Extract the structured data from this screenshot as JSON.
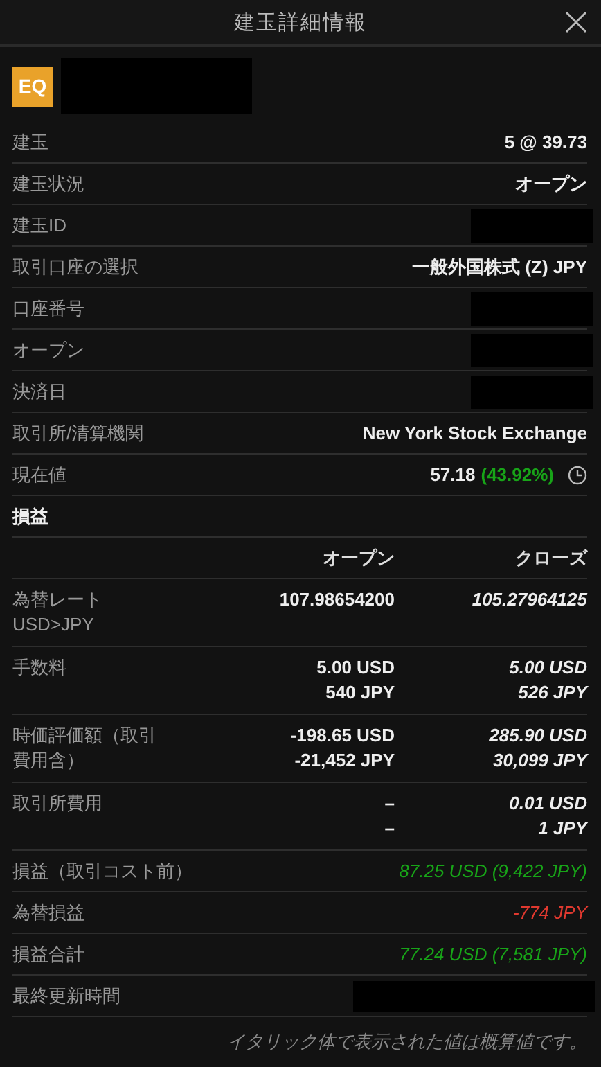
{
  "window": {
    "title": "建玉詳細情報"
  },
  "instrument": {
    "badge": "EQ"
  },
  "details": [
    {
      "label": "建玉",
      "value": "5 @ 39.73"
    },
    {
      "label": "建玉状況",
      "value": "オープン"
    },
    {
      "label": "建玉ID"
    },
    {
      "label": "取引口座の選択",
      "value": "一般外国株式 (Z) JPY"
    },
    {
      "label": "口座番号"
    },
    {
      "label": "オープン"
    },
    {
      "label": "決済日"
    },
    {
      "label": "取引所/清算機関",
      "value": "New York Stock Exchange"
    },
    {
      "label": "現在値",
      "value": "57.18",
      "change": "(43.92%)",
      "positive": true
    }
  ],
  "pnl": {
    "title": "損益",
    "columns": [
      "オープン",
      "クローズ"
    ],
    "rows": [
      {
        "label": "為替レート USD>JPY",
        "open": {
          "lines": [
            "107.98654200"
          ],
          "estimated": false
        },
        "close": {
          "lines": [
            "105.27964125"
          ],
          "estimated": true
        }
      },
      {
        "label": "手数料",
        "open": {
          "lines": [
            "5.00 USD",
            "540 JPY"
          ],
          "estimated": false
        },
        "close": {
          "lines": [
            "5.00 USD",
            "526 JPY"
          ],
          "estimated": true
        }
      },
      {
        "label": "時価評価額（取引費用含）",
        "open": {
          "lines": [
            "-198.65 USD",
            "-21,452 JPY"
          ],
          "estimated": false
        },
        "close": {
          "lines": [
            "285.90 USD",
            "30,099 JPY"
          ],
          "estimated": true
        }
      },
      {
        "label": "取引所費用",
        "open": {
          "lines": [
            "–",
            "–"
          ],
          "estimated": false
        },
        "close": {
          "lines": [
            "0.01 USD",
            "1 JPY"
          ],
          "estimated": true
        }
      }
    ],
    "totals": [
      {
        "label": "損益（取引コスト前）",
        "value": "87.25 USD (9,422 JPY)",
        "positive": true,
        "estimated": true
      },
      {
        "label": "為替損益",
        "value": "-774 JPY",
        "positive": false,
        "estimated": true
      },
      {
        "label": "損益合計",
        "value": "77.24 USD (7,581 JPY)",
        "positive": true,
        "estimated": true
      },
      {
        "label": "最終更新時間"
      }
    ]
  },
  "footnote": "イタリック体で表示された値は概算値です。"
}
